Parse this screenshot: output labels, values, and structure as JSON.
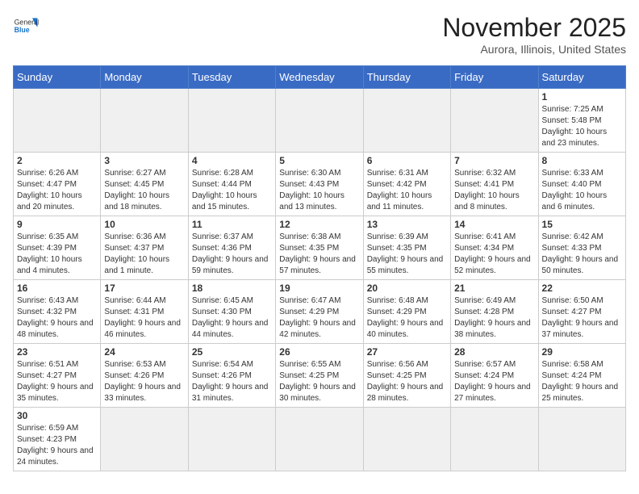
{
  "header": {
    "logo_general": "General",
    "logo_blue": "Blue",
    "month_year": "November 2025",
    "location": "Aurora, Illinois, United States"
  },
  "days_of_week": [
    "Sunday",
    "Monday",
    "Tuesday",
    "Wednesday",
    "Thursday",
    "Friday",
    "Saturday"
  ],
  "weeks": [
    [
      {
        "day": "",
        "info": "",
        "empty": true
      },
      {
        "day": "",
        "info": "",
        "empty": true
      },
      {
        "day": "",
        "info": "",
        "empty": true
      },
      {
        "day": "",
        "info": "",
        "empty": true
      },
      {
        "day": "",
        "info": "",
        "empty": true
      },
      {
        "day": "",
        "info": "",
        "empty": true
      },
      {
        "day": "1",
        "info": "Sunrise: 7:25 AM\nSunset: 5:48 PM\nDaylight: 10 hours and 23 minutes."
      }
    ],
    [
      {
        "day": "2",
        "info": "Sunrise: 6:26 AM\nSunset: 4:47 PM\nDaylight: 10 hours and 20 minutes."
      },
      {
        "day": "3",
        "info": "Sunrise: 6:27 AM\nSunset: 4:45 PM\nDaylight: 10 hours and 18 minutes."
      },
      {
        "day": "4",
        "info": "Sunrise: 6:28 AM\nSunset: 4:44 PM\nDaylight: 10 hours and 15 minutes."
      },
      {
        "day": "5",
        "info": "Sunrise: 6:30 AM\nSunset: 4:43 PM\nDaylight: 10 hours and 13 minutes."
      },
      {
        "day": "6",
        "info": "Sunrise: 6:31 AM\nSunset: 4:42 PM\nDaylight: 10 hours and 11 minutes."
      },
      {
        "day": "7",
        "info": "Sunrise: 6:32 AM\nSunset: 4:41 PM\nDaylight: 10 hours and 8 minutes."
      },
      {
        "day": "8",
        "info": "Sunrise: 6:33 AM\nSunset: 4:40 PM\nDaylight: 10 hours and 6 minutes."
      }
    ],
    [
      {
        "day": "9",
        "info": "Sunrise: 6:35 AM\nSunset: 4:39 PM\nDaylight: 10 hours and 4 minutes."
      },
      {
        "day": "10",
        "info": "Sunrise: 6:36 AM\nSunset: 4:37 PM\nDaylight: 10 hours and 1 minute."
      },
      {
        "day": "11",
        "info": "Sunrise: 6:37 AM\nSunset: 4:36 PM\nDaylight: 9 hours and 59 minutes."
      },
      {
        "day": "12",
        "info": "Sunrise: 6:38 AM\nSunset: 4:35 PM\nDaylight: 9 hours and 57 minutes."
      },
      {
        "day": "13",
        "info": "Sunrise: 6:39 AM\nSunset: 4:35 PM\nDaylight: 9 hours and 55 minutes."
      },
      {
        "day": "14",
        "info": "Sunrise: 6:41 AM\nSunset: 4:34 PM\nDaylight: 9 hours and 52 minutes."
      },
      {
        "day": "15",
        "info": "Sunrise: 6:42 AM\nSunset: 4:33 PM\nDaylight: 9 hours and 50 minutes."
      }
    ],
    [
      {
        "day": "16",
        "info": "Sunrise: 6:43 AM\nSunset: 4:32 PM\nDaylight: 9 hours and 48 minutes."
      },
      {
        "day": "17",
        "info": "Sunrise: 6:44 AM\nSunset: 4:31 PM\nDaylight: 9 hours and 46 minutes."
      },
      {
        "day": "18",
        "info": "Sunrise: 6:45 AM\nSunset: 4:30 PM\nDaylight: 9 hours and 44 minutes."
      },
      {
        "day": "19",
        "info": "Sunrise: 6:47 AM\nSunset: 4:29 PM\nDaylight: 9 hours and 42 minutes."
      },
      {
        "day": "20",
        "info": "Sunrise: 6:48 AM\nSunset: 4:29 PM\nDaylight: 9 hours and 40 minutes."
      },
      {
        "day": "21",
        "info": "Sunrise: 6:49 AM\nSunset: 4:28 PM\nDaylight: 9 hours and 38 minutes."
      },
      {
        "day": "22",
        "info": "Sunrise: 6:50 AM\nSunset: 4:27 PM\nDaylight: 9 hours and 37 minutes."
      }
    ],
    [
      {
        "day": "23",
        "info": "Sunrise: 6:51 AM\nSunset: 4:27 PM\nDaylight: 9 hours and 35 minutes."
      },
      {
        "day": "24",
        "info": "Sunrise: 6:53 AM\nSunset: 4:26 PM\nDaylight: 9 hours and 33 minutes."
      },
      {
        "day": "25",
        "info": "Sunrise: 6:54 AM\nSunset: 4:26 PM\nDaylight: 9 hours and 31 minutes."
      },
      {
        "day": "26",
        "info": "Sunrise: 6:55 AM\nSunset: 4:25 PM\nDaylight: 9 hours and 30 minutes."
      },
      {
        "day": "27",
        "info": "Sunrise: 6:56 AM\nSunset: 4:25 PM\nDaylight: 9 hours and 28 minutes."
      },
      {
        "day": "28",
        "info": "Sunrise: 6:57 AM\nSunset: 4:24 PM\nDaylight: 9 hours and 27 minutes."
      },
      {
        "day": "29",
        "info": "Sunrise: 6:58 AM\nSunset: 4:24 PM\nDaylight: 9 hours and 25 minutes."
      }
    ],
    [
      {
        "day": "30",
        "info": "Sunrise: 6:59 AM\nSunset: 4:23 PM\nDaylight: 9 hours and 24 minutes.",
        "has_data": true
      },
      {
        "day": "",
        "info": "",
        "empty": true
      },
      {
        "day": "",
        "info": "",
        "empty": true
      },
      {
        "day": "",
        "info": "",
        "empty": true
      },
      {
        "day": "",
        "info": "",
        "empty": true
      },
      {
        "day": "",
        "info": "",
        "empty": true
      },
      {
        "day": "",
        "info": "",
        "empty": true
      }
    ]
  ]
}
